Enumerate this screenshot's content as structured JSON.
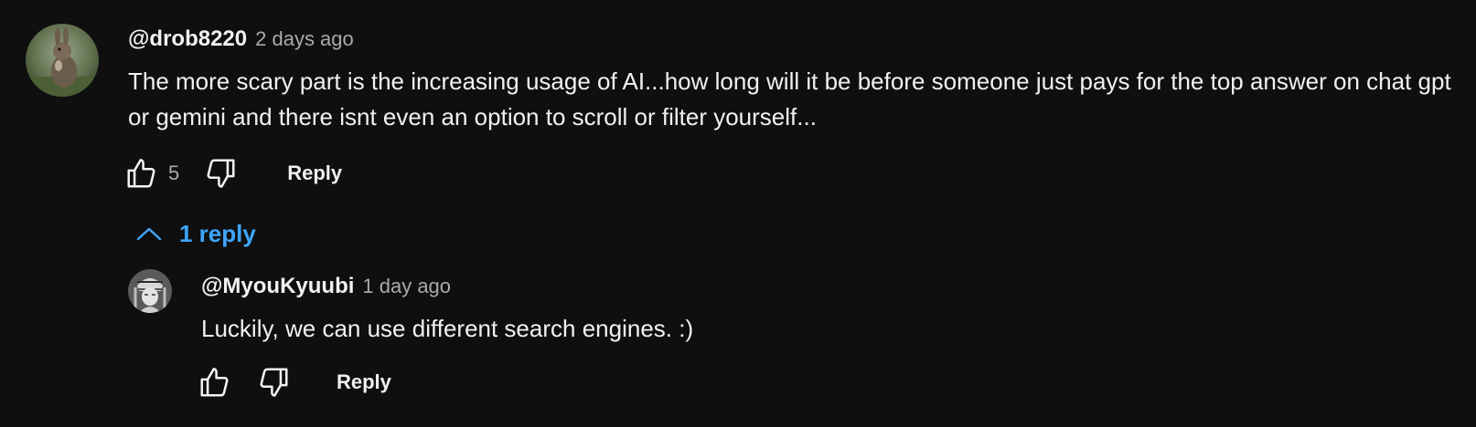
{
  "comments": {
    "main": {
      "author": "@drob8220",
      "time": "2 days ago",
      "text": "The more scary part is the increasing usage of AI...how long will it be before someone just pays for the top answer on chat gpt or gemini and there isnt even an option to scroll or filter yourself...",
      "likes": "5",
      "reply_label": "Reply",
      "avatar_icon": "rabbit-avatar"
    },
    "replies_toggle": {
      "label": "1 reply",
      "icon": "chevron-up-icon",
      "color": "#3ea6ff"
    },
    "reply": {
      "author": "@MyouKyuubi",
      "time": "1 day ago",
      "text": "Luckily, we can use different search engines. :)",
      "reply_label": "Reply",
      "avatar_icon": "character-avatar"
    }
  },
  "colors": {
    "background": "#0f0f0f",
    "text_primary": "#f1f1f1",
    "text_secondary": "#aaaaaa",
    "link": "#3ea6ff"
  }
}
